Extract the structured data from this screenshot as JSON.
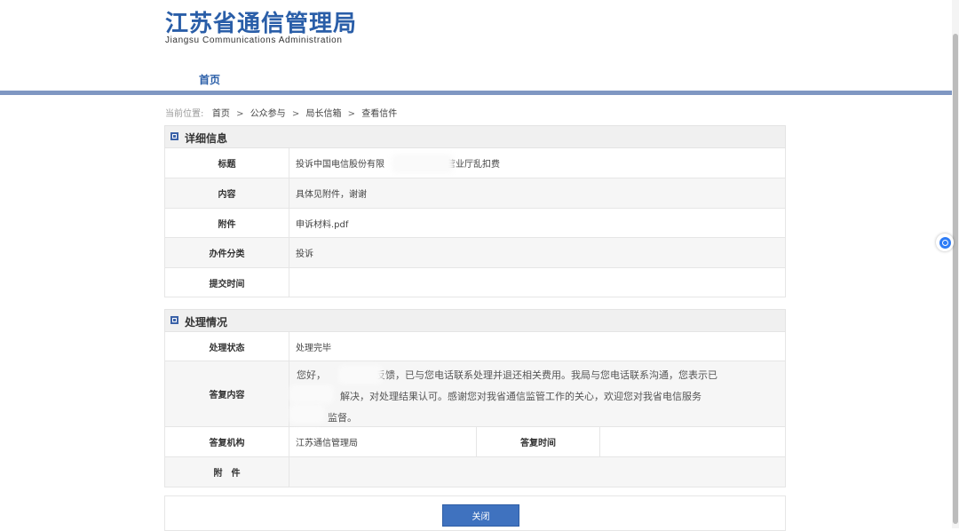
{
  "header": {
    "title_cn": "江苏省通信管理局",
    "title_en": "Jiangsu Communications Administration"
  },
  "nav": {
    "home": "首页"
  },
  "breadcrumb": {
    "label": "当前位置:",
    "items": [
      "首页",
      "公众参与",
      "局长信箱",
      "查看信件"
    ],
    "separator": ">"
  },
  "detail": {
    "section_title": "详细信息",
    "title_label": "标题",
    "title_value_start": "投诉中国电信股份有限",
    "title_value_end": "营业厅乱扣费",
    "content_label": "内容",
    "content_value": "具体见附件，谢谢",
    "attachment_label": "附件",
    "attachment_value": "申诉材料.pdf",
    "category_label": "办件分类",
    "category_value": "投诉",
    "submit_time_label": "提交时间",
    "submit_time_value": ""
  },
  "processing": {
    "section_title": "处理情况",
    "status_label": "处理状态",
    "status_value": "处理完毕",
    "reply_label": "答复内容",
    "reply_lines": [
      "您好，                反馈，已与您电话联系处理并退还相关费用。我局与您电话联系沟通，您表示已",
      "              解决，对处理结果认可。感谢您对我省通信监管工作的关心，欢迎您对我省电信服务",
      "          监督。"
    ],
    "agency_label": "答复机构",
    "agency_value": "江苏通信管理局",
    "reply_time_label": "答复时间",
    "reply_time_value": "",
    "attach_label": "附　件"
  },
  "actions": {
    "close": "关闭"
  },
  "colors": {
    "brand": "#2a5ea8",
    "nav_bar": "#7f97c2",
    "button": "#3f72bf"
  }
}
